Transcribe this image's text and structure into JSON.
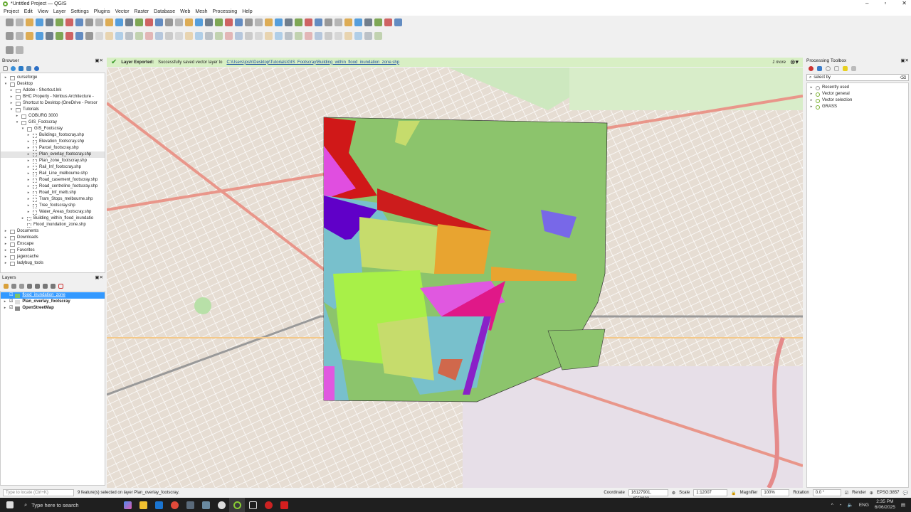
{
  "window": {
    "title": "*Untitled Project — QGIS"
  },
  "menu": [
    "Project",
    "Edit",
    "View",
    "Layer",
    "Settings",
    "Plugins",
    "Vector",
    "Raster",
    "Database",
    "Web",
    "Mesh",
    "Processing",
    "Help"
  ],
  "browser": {
    "title": "Browser",
    "items": [
      {
        "label": "curseforge",
        "depth": 1,
        "type": "folder",
        "arrow": "▸"
      },
      {
        "label": "Desktop",
        "depth": 1,
        "type": "folder",
        "arrow": "▾"
      },
      {
        "label": "Adobe - Shortcut.lnk",
        "depth": 2,
        "type": "file",
        "arrow": "▸"
      },
      {
        "label": "BHC Property - Nimbus Architecture -",
        "depth": 2,
        "type": "file",
        "arrow": "▸"
      },
      {
        "label": "Shortcut to Desktop (OneDrive - Persor",
        "depth": 2,
        "type": "file",
        "arrow": "▸"
      },
      {
        "label": "Tutorials",
        "depth": 2,
        "type": "folder",
        "arrow": "▾"
      },
      {
        "label": "COBURG 3000",
        "depth": 3,
        "type": "folder",
        "arrow": "▸"
      },
      {
        "label": "GIS_Footscray",
        "depth": 3,
        "type": "folder",
        "arrow": "▾"
      },
      {
        "label": "GIS_Footscray",
        "depth": 4,
        "type": "folder",
        "arrow": "▾"
      },
      {
        "label": "Buildings_footscray.shp",
        "depth": 5,
        "type": "shp",
        "arrow": "▸"
      },
      {
        "label": "Elevation_footscray.shp",
        "depth": 5,
        "type": "shp",
        "arrow": "▸"
      },
      {
        "label": "Parcel_footscray.shp",
        "depth": 5,
        "type": "shp",
        "arrow": "▸"
      },
      {
        "label": "Plan_overlay_footscray.shp",
        "depth": 5,
        "type": "shp",
        "arrow": "▸",
        "selected": true
      },
      {
        "label": "Plan_zone_footscray.shp",
        "depth": 5,
        "type": "shp",
        "arrow": "▸"
      },
      {
        "label": "Rail_Inf_footscray.shp",
        "depth": 5,
        "type": "shp",
        "arrow": "▸"
      },
      {
        "label": "Rail_Line_melbourne.shp",
        "depth": 5,
        "type": "shp",
        "arrow": "▸"
      },
      {
        "label": "Road_casement_footscray.shp",
        "depth": 5,
        "type": "shp",
        "arrow": "▸"
      },
      {
        "label": "Road_centreline_footscray.shp",
        "depth": 5,
        "type": "shp",
        "arrow": "▸"
      },
      {
        "label": "Road_Inf_melb.shp",
        "depth": 5,
        "type": "shp",
        "arrow": "▸"
      },
      {
        "label": "Tram_Stops_melbourne.shp",
        "depth": 5,
        "type": "shp",
        "arrow": "▸"
      },
      {
        "label": "Tree_footscray.shp",
        "depth": 5,
        "type": "shp",
        "arrow": "▸"
      },
      {
        "label": "Water_Areas_footscray.shp",
        "depth": 5,
        "type": "shp",
        "arrow": "▸"
      },
      {
        "label": "Building_within_flood_inundatio",
        "depth": 4,
        "type": "shp",
        "arrow": "▸"
      },
      {
        "label": "Flood_inundation_zone.shp",
        "depth": 4,
        "type": "shp",
        "arrow": ""
      },
      {
        "label": "Documents",
        "depth": 1,
        "type": "folder",
        "arrow": "▸"
      },
      {
        "label": "Downloads",
        "depth": 1,
        "type": "folder",
        "arrow": "▸"
      },
      {
        "label": "Enscape",
        "depth": 1,
        "type": "folder",
        "arrow": "▸"
      },
      {
        "label": "Favorites",
        "depth": 1,
        "type": "folder",
        "arrow": "▸"
      },
      {
        "label": "jagexcache",
        "depth": 1,
        "type": "folder",
        "arrow": "▸"
      },
      {
        "label": "ladybug_tools",
        "depth": 1,
        "type": "folder",
        "arrow": "▸"
      }
    ]
  },
  "layers": {
    "title": "Layers",
    "items": [
      {
        "label": "flood_inundation_zone",
        "checked": true,
        "selected": true,
        "color": "#7cc36a"
      },
      {
        "label": "Plan_overlay_footscray",
        "checked": true,
        "selected": false,
        "color": "#dddddd"
      },
      {
        "label": "OpenStreetMap",
        "checked": true,
        "selected": false,
        "color": "#888888"
      }
    ]
  },
  "message": {
    "title": "Layer Exported:",
    "text": "Successfully saved vector layer to",
    "link": "C:\\Users\\josh\\Desktop\\Tutorials\\GIS_Footscray\\Building_within_flood_inundation_zone.shp",
    "more": "1 more"
  },
  "processing": {
    "title": "Processing Toolbox",
    "search_value": "select by",
    "items": [
      "Recently used",
      "Vector general",
      "Vector selection",
      "GRASS"
    ]
  },
  "status": {
    "locate_placeholder": "Type to locate (Ctrl+K)",
    "message": "9 feature(s) selected on layer Plan_overlay_footscray.",
    "coordinate_label": "Coordinate",
    "coordinate": "16127901, -4550933",
    "scale_label": "Scale",
    "scale": "1:12007",
    "magnifier_label": "Magnifier",
    "magnifier": "100%",
    "rotation_label": "Rotation",
    "rotation": "0.0 °",
    "render_label": "Render",
    "crs": "EPSG:3857"
  },
  "taskbar": {
    "search_placeholder": "Type here to search",
    "time": "2:35 PM",
    "date": "6/06/2025",
    "lang": "ENG"
  },
  "colors": {
    "accent": "#3399ff",
    "map_bg": "#ede6dd"
  }
}
